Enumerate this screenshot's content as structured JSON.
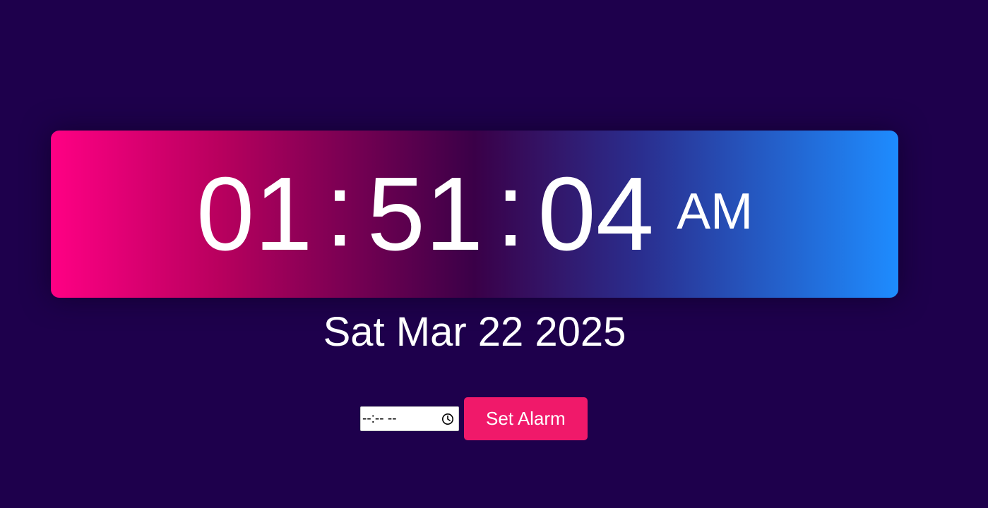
{
  "clock": {
    "hours": "01",
    "minutes": "51",
    "seconds": "04",
    "separator": ":",
    "ampm": "AM"
  },
  "date": {
    "text": "Sat Mar 22 2025"
  },
  "alarm": {
    "input_placeholder": "--:-- --",
    "input_icon": "clock-icon",
    "button_label": "Set Alarm"
  },
  "colors": {
    "background": "#1e004c",
    "gradient_start": "#ff0084",
    "gradient_end": "#1e8cff",
    "button": "#f0196a",
    "text": "#ffffff"
  }
}
